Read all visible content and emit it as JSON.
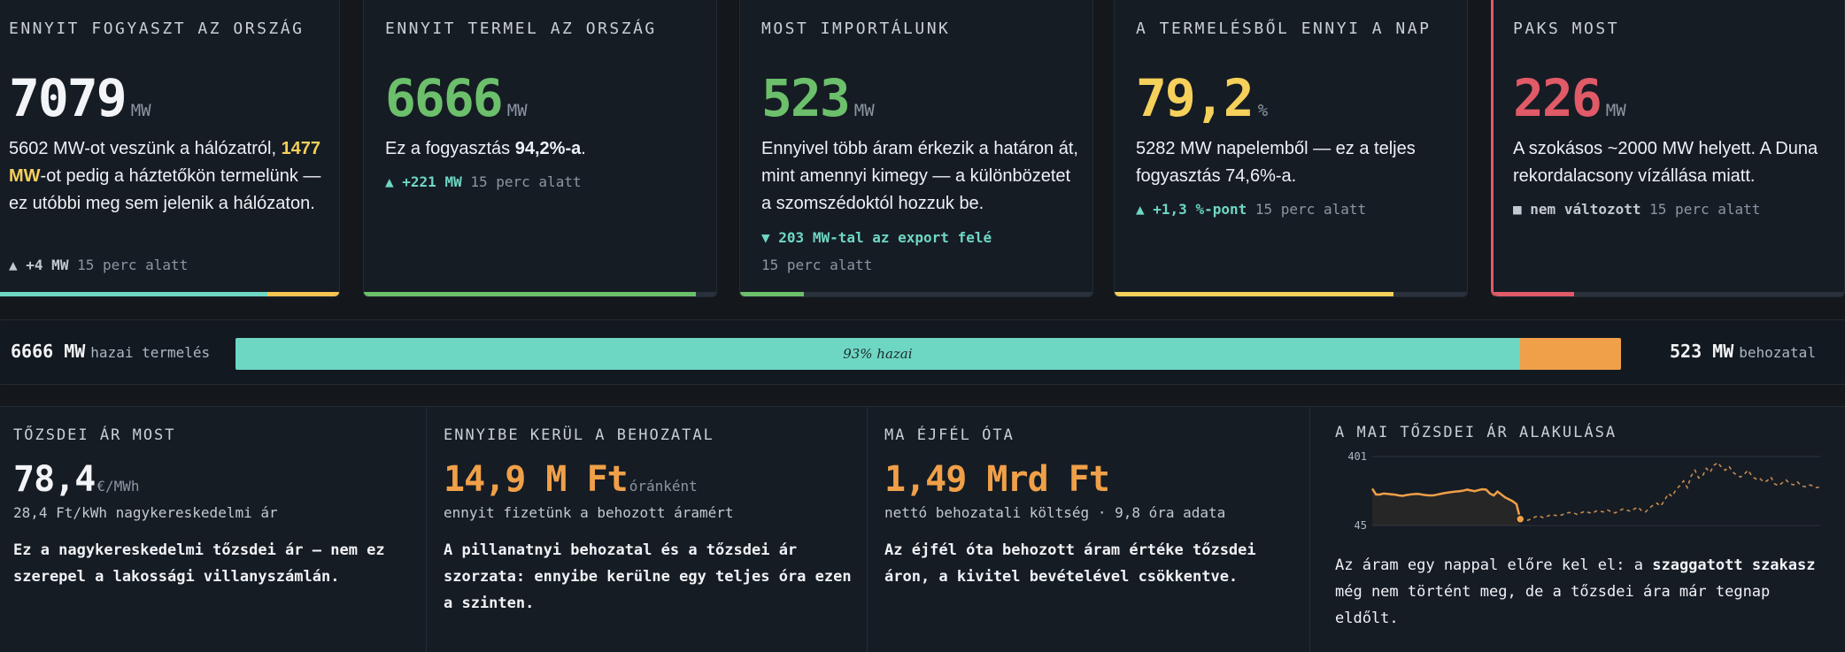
{
  "cards": [
    {
      "label": "ENNYIT FOGYASZT AZ ORSZÁG",
      "value": "7079",
      "unit": "MW",
      "value_color": "#f2f4f7",
      "desc_parts": [
        {
          "text": "5602 MW-ot veszünk a hálózatról, ",
          "style": "normal"
        },
        {
          "text": "1477 MW",
          "style": "yellow"
        },
        {
          "text": "-ot pedig a háztetőkön termelünk — ez utóbbi meg sem jelenik a hálózaton.",
          "style": "normal"
        }
      ],
      "change_arrow": "▲",
      "change_strong": "+4 MW",
      "change_rest": "15 perc alatt",
      "change_color": "#c3c9d0",
      "bar_segments": [
        {
          "fraction": 0.7914,
          "color": "#6ed7c4"
        },
        {
          "fraction": 0.2086,
          "color": "#f5c451"
        }
      ]
    },
    {
      "label": "ENNYIT TERMEL AZ ORSZÁG",
      "value": "6666",
      "unit": "MW",
      "value_color": "#6cbf6b",
      "desc_parts": [
        {
          "text": "Ez a fogyasztás ",
          "style": "normal"
        },
        {
          "text": "94,2%-a",
          "style": "bold"
        },
        {
          "text": ".",
          "style": "normal"
        }
      ],
      "change_arrow": "▲",
      "change_strong": "+221 MW",
      "change_rest": "15 perc alatt",
      "change_color": "#6ed7c4",
      "bar_segments": [
        {
          "fraction": 0.942,
          "color": "#6cbf6b"
        }
      ]
    },
    {
      "label": "MOST IMPORTÁLUNK",
      "value": "523",
      "unit": "MW",
      "value_color": "#6cbf6b",
      "desc_parts": [
        {
          "text": "Ennyivel több áram érkezik a határon át, mint amennyi kimegy — a különbözetet a szomszédoktól hozzuk be.",
          "style": "normal"
        }
      ],
      "change_arrow": "▼",
      "change_strong": "203 MW-tal az export felé",
      "change_rest": "15 perc alatt",
      "change_color": "#6ed7c4",
      "bar_segments": [
        {
          "fraction": 0.18,
          "color": "#6cbf6b"
        }
      ]
    },
    {
      "label": "A TERMELÉSBŐL ENNYI A NAP",
      "value": "79,2",
      "unit": "%",
      "value_color": "#f5d05a",
      "desc_parts": [
        {
          "text": "5282 MW napelemből — ez a teljes fogyasztás 74,6%-a.",
          "style": "normal"
        }
      ],
      "change_arrow": "▲",
      "change_strong": "+1,3 %-pont",
      "change_rest": "15 perc alatt",
      "change_color": "#6ed7c4",
      "bar_segments": [
        {
          "fraction": 0.792,
          "color": "#f5d05a"
        }
      ]
    },
    {
      "label": "PAKS MOST",
      "value": "226",
      "unit": "MW",
      "value_color": "#e05a67",
      "desc_parts": [
        {
          "text": "A szokásos ~2000 MW helyett. A Duna rekordalacsony vízállása miatt.",
          "style": "normal"
        }
      ],
      "change_arrow": "■",
      "change_strong": "nem változott",
      "change_rest": "15 perc alatt",
      "change_color": "#c3c9d0",
      "bar_segments": [
        {
          "fraction": 0.23,
          "color": "#e05a67"
        }
      ]
    }
  ],
  "share": {
    "left_value": "6666 MW",
    "left_label": "hazai termelés",
    "right_value": "523 MW",
    "right_label": "behozatal",
    "home_fraction": 0.927,
    "bar_text": "93% hazai",
    "home_color": "#6ed7c4",
    "import_color": "#f0a048"
  },
  "panels": [
    {
      "label": "TŐZSDEI ÁR MOST",
      "value": "78,4",
      "unit": "€/MWh",
      "value_color": "#f2f4f7",
      "sub": "28,4 Ft/kWh nagykereskedelmi ár",
      "text": "Ez a nagykereskedelmi tőzsdei ár — nem ez szerepel a lakossági villanyszámlán."
    },
    {
      "label": "ENNYIBE KERÜL A BEHOZATAL",
      "value": "14,9 M Ft",
      "unit": "óránként",
      "value_color": "#f0a048",
      "sub": "ennyit fizetünk a behozott áramért",
      "text": "A pillanatnyi behozatal és a tőzsdei ár szorzata: ennyibe kerülne egy teljes óra ezen a szinten."
    },
    {
      "label": "MA ÉJFÉL ÓTA",
      "value": "1,49 Mrd Ft",
      "unit": "",
      "value_color": "#f0a048",
      "sub": "nettó behozatali költség · 9,8 óra adata",
      "text": "Az éjfél óta behozott áram értéke tőzsdei áron, a kivitel bevételével csökkentve."
    }
  ],
  "price_chart": {
    "label": "A MAI TŐZSDEI ÁR ALAKULÁSA",
    "text_parts": [
      {
        "text": "Az áram egy nappal előre kel el: a ",
        "style": "normal"
      },
      {
        "text": "szaggatott szakasz",
        "style": "bold"
      },
      {
        "text": " még nem történt meg, de a tőzsdei ára már tegnap eldőlt.",
        "style": "normal"
      }
    ],
    "chart_data": {
      "type": "line",
      "ylim": [
        45,
        401
      ],
      "yticks": [
        "401",
        "45"
      ],
      "series": [
        {
          "style": "solid",
          "color": "#f0a048",
          "x": [
            0,
            1,
            2,
            3,
            4,
            5,
            6,
            7,
            8,
            9,
            10,
            11,
            12,
            13,
            14,
            15,
            16,
            17,
            18,
            19,
            20,
            21,
            22,
            23,
            24,
            25,
            26,
            27,
            28,
            29,
            30,
            31,
            32,
            33,
            34,
            35,
            36,
            37,
            38,
            39
          ],
          "y": [
            235,
            205,
            205,
            210,
            208,
            206,
            204,
            200,
            198,
            202,
            205,
            207,
            208,
            205,
            202,
            200,
            200,
            204,
            208,
            212,
            215,
            218,
            220,
            222,
            225,
            230,
            226,
            222,
            228,
            232,
            230,
            210,
            200,
            220,
            205,
            190,
            180,
            170,
            155,
            78
          ]
        },
        {
          "style": "dashed",
          "color": "#c48a50",
          "x": [
            39,
            40,
            41,
            42,
            43,
            44,
            45,
            46,
            47,
            48,
            49,
            50,
            51,
            52,
            53,
            54,
            55,
            56,
            57,
            58,
            59,
            60,
            61,
            62,
            63,
            64,
            65,
            66,
            67,
            68,
            69,
            70,
            71,
            72,
            73,
            74,
            75,
            76,
            77,
            78,
            79,
            80,
            81,
            82,
            83,
            84,
            85,
            86,
            87,
            88,
            89,
            90,
            91,
            92,
            93,
            94,
            95,
            96,
            97,
            98,
            99,
            100,
            101,
            102,
            103,
            104,
            105,
            106,
            107,
            108,
            109,
            110,
            111,
            112,
            113,
            114,
            115,
            116,
            117,
            118
          ],
          "y": [
            78,
            70,
            72,
            80,
            90,
            95,
            85,
            92,
            100,
            98,
            95,
            100,
            108,
            112,
            110,
            102,
            110,
            118,
            112,
            108,
            120,
            118,
            115,
            125,
            115,
            110,
            120,
            130,
            125,
            118,
            130,
            140,
            120,
            115,
            135,
            150,
            160,
            145,
            175,
            210,
            195,
            230,
            250,
            275,
            240,
            300,
            330,
            290,
            300,
            340,
            320,
            355,
            370,
            345,
            330,
            350,
            320,
            305,
            295,
            310,
            330,
            300,
            285,
            290,
            270,
            275,
            295,
            260,
            250,
            265,
            280,
            260,
            255,
            270,
            250,
            245,
            255,
            250,
            240,
            245
          ]
        }
      ]
    }
  }
}
